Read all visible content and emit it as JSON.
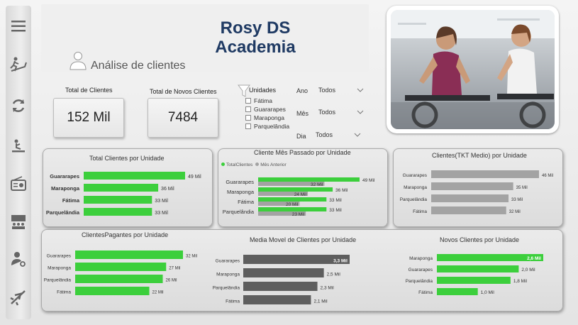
{
  "colors": {
    "green": "#3ccf3c",
    "gray_bar": "#a3a3a3",
    "dark_bar": "#5e5e5e",
    "title_blue": "#1f3a63"
  },
  "nav": [
    {
      "icon": "menu-icon"
    },
    {
      "icon": "treadmill-icon"
    },
    {
      "icon": "refresh-icon"
    },
    {
      "icon": "exercise-icon"
    },
    {
      "icon": "radio-icon"
    },
    {
      "icon": "group-icon"
    },
    {
      "icon": "user-search-icon"
    },
    {
      "icon": "airplane-icon"
    }
  ],
  "header": {
    "title_line1": "Rosy DS",
    "title_line2": "Academia",
    "subtitle": "Análise de clientes"
  },
  "kpis": {
    "total_clientes_label": "Total de Clientes",
    "total_clientes_value": "152 Mil",
    "novos_clientes_label": "Total de Novos Clientes",
    "novos_clientes_value": "7484"
  },
  "filters": {
    "unidades_title": "Unidades",
    "unidades_options": [
      "Fátima",
      "Guararapes",
      "Maraponga",
      "Parquelândia"
    ],
    "ano_label": "Ano",
    "ano_value": "Todos",
    "mes_label": "Mês",
    "mes_value": "Todos",
    "dia_label": "Dia",
    "dia_value": "Todos"
  },
  "chart_data": [
    {
      "id": "c1",
      "type": "bar",
      "title": "Total Clientes por Unidade",
      "categories": [
        "Guararapes",
        "Maraponga",
        "Fátima",
        "Parquelândia"
      ],
      "values": [
        49,
        36,
        33,
        33
      ],
      "data_labels": [
        "49 Mil",
        "36 Mil",
        "33 Mil",
        "33 Mil"
      ]
    },
    {
      "id": "c2",
      "type": "bar",
      "title": "Cliente Mês Passado por Unidade",
      "categories": [
        "Guararapes",
        "Maraponga",
        "Fátima",
        "Parquelândia"
      ],
      "series": [
        {
          "name": "TotalClientes",
          "values": [
            49,
            36,
            33,
            33
          ],
          "data_labels": [
            "49 Mil",
            "36 Mil",
            "33 Mil",
            "33 Mil"
          ]
        },
        {
          "name": "Mês Anterior",
          "values": [
            32,
            24,
            20,
            23
          ],
          "data_labels": [
            "32 Mil",
            "24 Mil",
            "20 Mil",
            "23 Mil"
          ]
        }
      ]
    },
    {
      "id": "c3",
      "type": "bar",
      "title": "Clientes(TKT Medio) por Unidade",
      "categories": [
        "Guararapes",
        "Maraponga",
        "Parquelândia",
        "Fátima"
      ],
      "values": [
        46,
        35,
        33,
        32
      ],
      "data_labels": [
        "46 Mil",
        "35 Mil",
        "33 Mil",
        "32 Mil"
      ]
    },
    {
      "id": "c4",
      "type": "bar",
      "title": "ClientesPagantes por Unidade",
      "categories": [
        "Guararapes",
        "Maraponga",
        "Parquelândia",
        "Fátima"
      ],
      "values": [
        32,
        27,
        26,
        22
      ],
      "data_labels": [
        "32 Mil",
        "27 Mil",
        "26 Mil",
        "22 Mil"
      ]
    },
    {
      "id": "c5",
      "type": "bar",
      "title": "Media Movel de Clientes por Unidade",
      "categories": [
        "Guararapes",
        "Maraponga",
        "Parquelândia",
        "Fátima"
      ],
      "values": [
        3.3,
        2.5,
        2.3,
        2.1
      ],
      "data_labels": [
        "3,3 Mil",
        "2,5 Mil",
        "2,3 Mil",
        "2,1 Mil"
      ]
    },
    {
      "id": "c6",
      "type": "bar",
      "title": "Novos Clientes por Unidade",
      "categories": [
        "Maraponga",
        "Guararapes",
        "Parquelândia",
        "Fátima"
      ],
      "values": [
        2.6,
        2.0,
        1.8,
        1.0
      ],
      "data_labels": [
        "2,6 Mil",
        "2,0 Mil",
        "1,8 Mil",
        "1,0 Mil"
      ]
    }
  ]
}
